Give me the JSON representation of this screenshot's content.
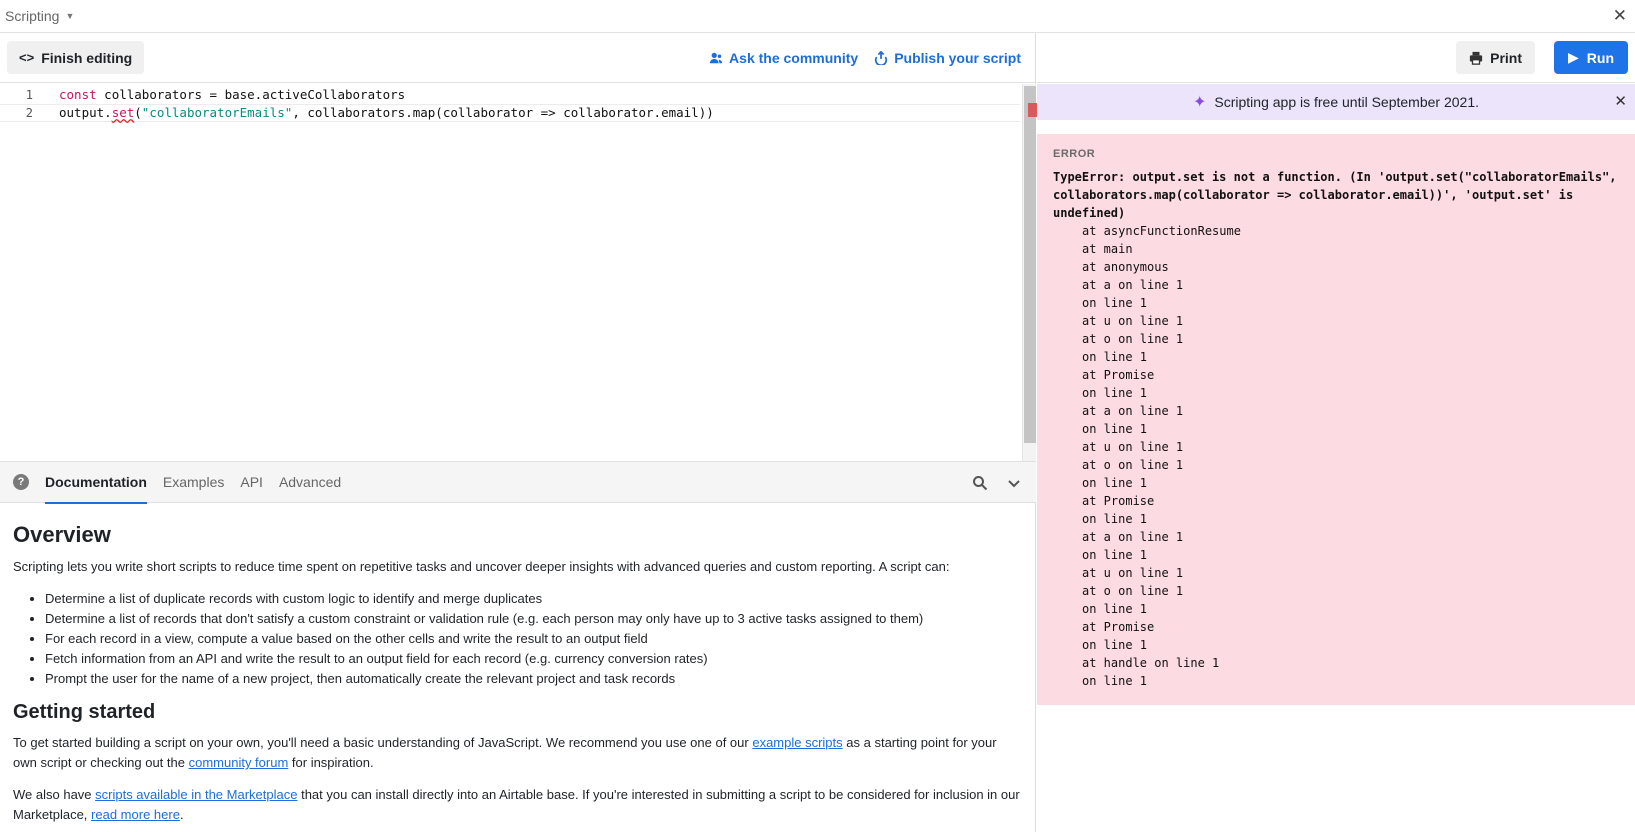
{
  "topbar": {
    "title": "Scripting"
  },
  "toolbar": {
    "finish_label": "Finish editing",
    "ask_label": "Ask the community",
    "publish_label": "Publish your script"
  },
  "editor": {
    "line_numbers": [
      "1",
      "2"
    ],
    "line1": {
      "kw": "const",
      "rest": " collaborators = base.activeCollaborators"
    },
    "line2": {
      "obj": "output.",
      "fn": "set",
      "open": "(",
      "str": "\"collaboratorEmails\"",
      "rest": ", collaborators.map(collaborator => collaborator.email))"
    }
  },
  "doc_tabs": [
    "Documentation",
    "Examples",
    "API",
    "Advanced"
  ],
  "doc": {
    "overview_title": "Overview",
    "overview_text": "Scripting lets you write short scripts to reduce time spent on repetitive tasks and uncover deeper insights with advanced queries and custom reporting. A script can:",
    "bullets": [
      "Determine a list of duplicate records with custom logic to identify and merge duplicates",
      "Determine a list of records that don't satisfy a custom constraint or validation rule (e.g. each person may only have up to 3 active tasks assigned to them)",
      "For each record in a view, compute a value based on the other cells and write the result to an output field",
      "Fetch information from an API and write the result to an output field for each record (e.g. currency conversion rates)",
      "Prompt the user for the name of a new project, then automatically create the relevant project and task records"
    ],
    "getting_started_title": "Getting started",
    "gs_p1_a": "To get started building a script on your own, you'll need a basic understanding of JavaScript. We recommend you use one of our ",
    "gs_p1_link1": "example scripts",
    "gs_p1_b": " as a starting point for your own script or checking out the ",
    "gs_p1_link2": "community forum",
    "gs_p1_c": " for inspiration.",
    "gs_p2_a": "We also have ",
    "gs_p2_link1": "scripts available in the Marketplace",
    "gs_p2_b": " that you can install directly into an Airtable base. If you're interested in submitting a script to be considered for inclusion in our Marketplace, ",
    "gs_p2_link2": "read more here",
    "gs_p2_c": "."
  },
  "right_toolbar": {
    "print_label": "Print",
    "run_label": "Run"
  },
  "banner": {
    "text": "Scripting app is free until September 2021."
  },
  "error": {
    "label": "ERROR",
    "message": "TypeError: output.set is not a function. (In 'output.set(\"collaboratorEmails\",\ncollaborators.map(collaborator => collaborator.email))', 'output.set' is\nundefined)",
    "stack": [
      "at asyncFunctionResume",
      "at main",
      "at anonymous",
      "at a on line 1",
      "on line 1",
      "at u on line 1",
      "at o on line 1",
      "on line 1",
      "at Promise",
      "on line 1",
      "at a on line 1",
      "on line 1",
      "at u on line 1",
      "at o on line 1",
      "on line 1",
      "at Promise",
      "on line 1",
      "at a on line 1",
      "on line 1",
      "at u on line 1",
      "at o on line 1",
      "on line 1",
      "at Promise",
      "on line 1",
      "at handle on line 1",
      "on line 1"
    ]
  }
}
